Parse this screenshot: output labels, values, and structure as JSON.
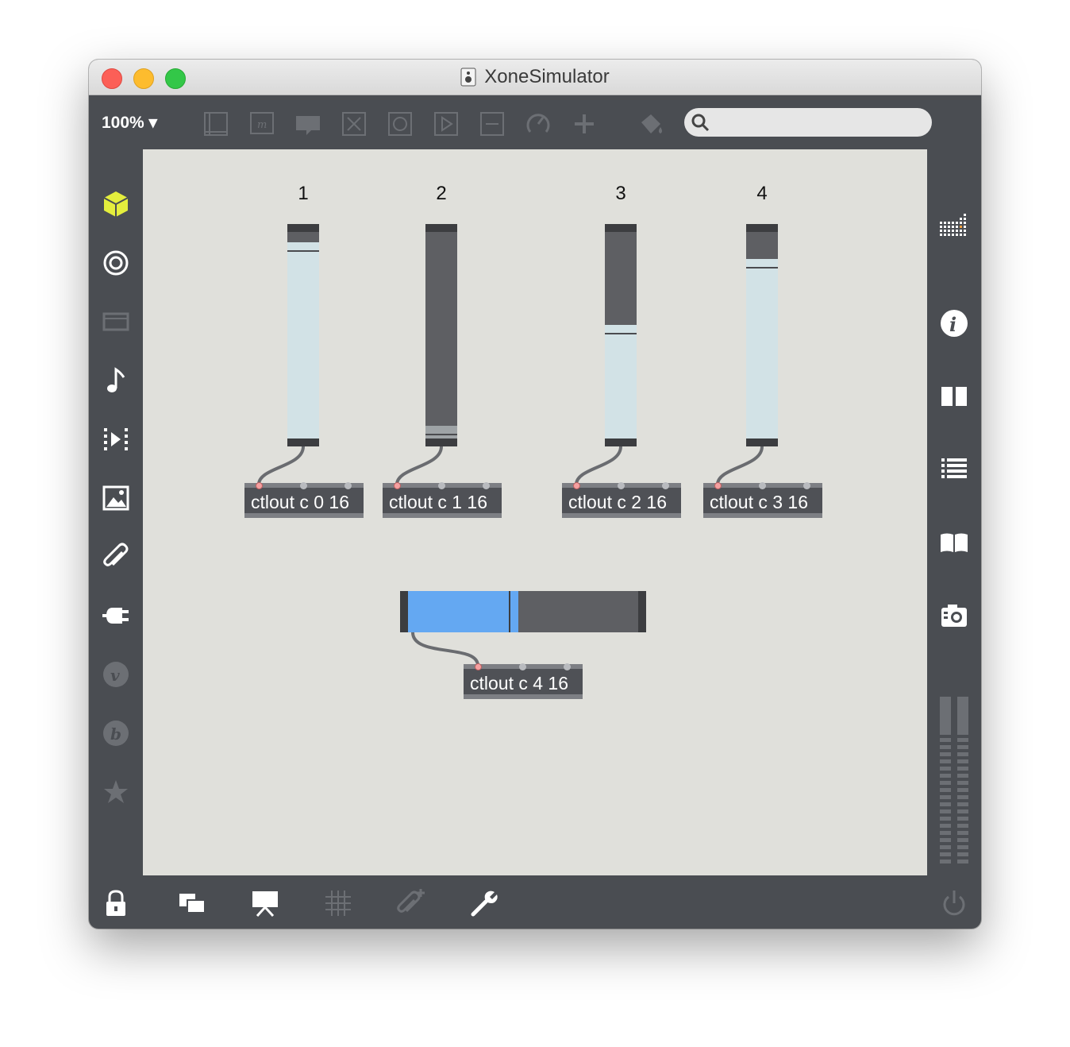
{
  "window": {
    "title": "XoneSimulator"
  },
  "toolbar": {
    "zoom": "100%",
    "search": {
      "placeholder": "",
      "value": ""
    },
    "icons": [
      "comment-box-icon",
      "message-icon",
      "speech-bubble-icon",
      "toggle-x-icon",
      "button-circle-icon",
      "play-button-icon",
      "slider-icon",
      "dial-icon",
      "plus-icon",
      "paint-bucket-icon"
    ]
  },
  "sidebar_left": [
    "package-cube-icon",
    "target-icon",
    "video-icon",
    "music-note-icon",
    "step-forward-icon",
    "image-icon",
    "paperclip-icon",
    "plug-icon",
    "v-circle-icon",
    "b-circle-icon",
    "star-icon"
  ],
  "sidebar_right": [
    "grid-icon",
    "info-icon",
    "split-view-icon",
    "list-icon",
    "book-icon",
    "camera-icon"
  ],
  "bottombar": [
    "lock-icon",
    "windows-icon",
    "presentation-icon",
    "grid-snap-icon",
    "paperclip-add-icon",
    "wrench-icon",
    "power-icon"
  ],
  "patch": {
    "sliders": [
      {
        "label": "1",
        "level": 0.95
      },
      {
        "label": "2",
        "level": 0.06
      },
      {
        "label": "3",
        "level": 0.55
      },
      {
        "label": "4",
        "level": 0.87
      }
    ],
    "objects": [
      "ctlout c 0 16",
      "ctlout c 1 16",
      "ctlout c 2 16",
      "ctlout c 3 16",
      "ctlout c 4 16"
    ],
    "hslider": {
      "level": 0.48
    }
  },
  "colors": {
    "accent_blue": "#64a8f2",
    "slider_fill": "#d2e2e6",
    "slider_bg": "#5e5f63",
    "canvas_bg": "#e0e0db",
    "cube_yellow": "#e4ee3d"
  }
}
